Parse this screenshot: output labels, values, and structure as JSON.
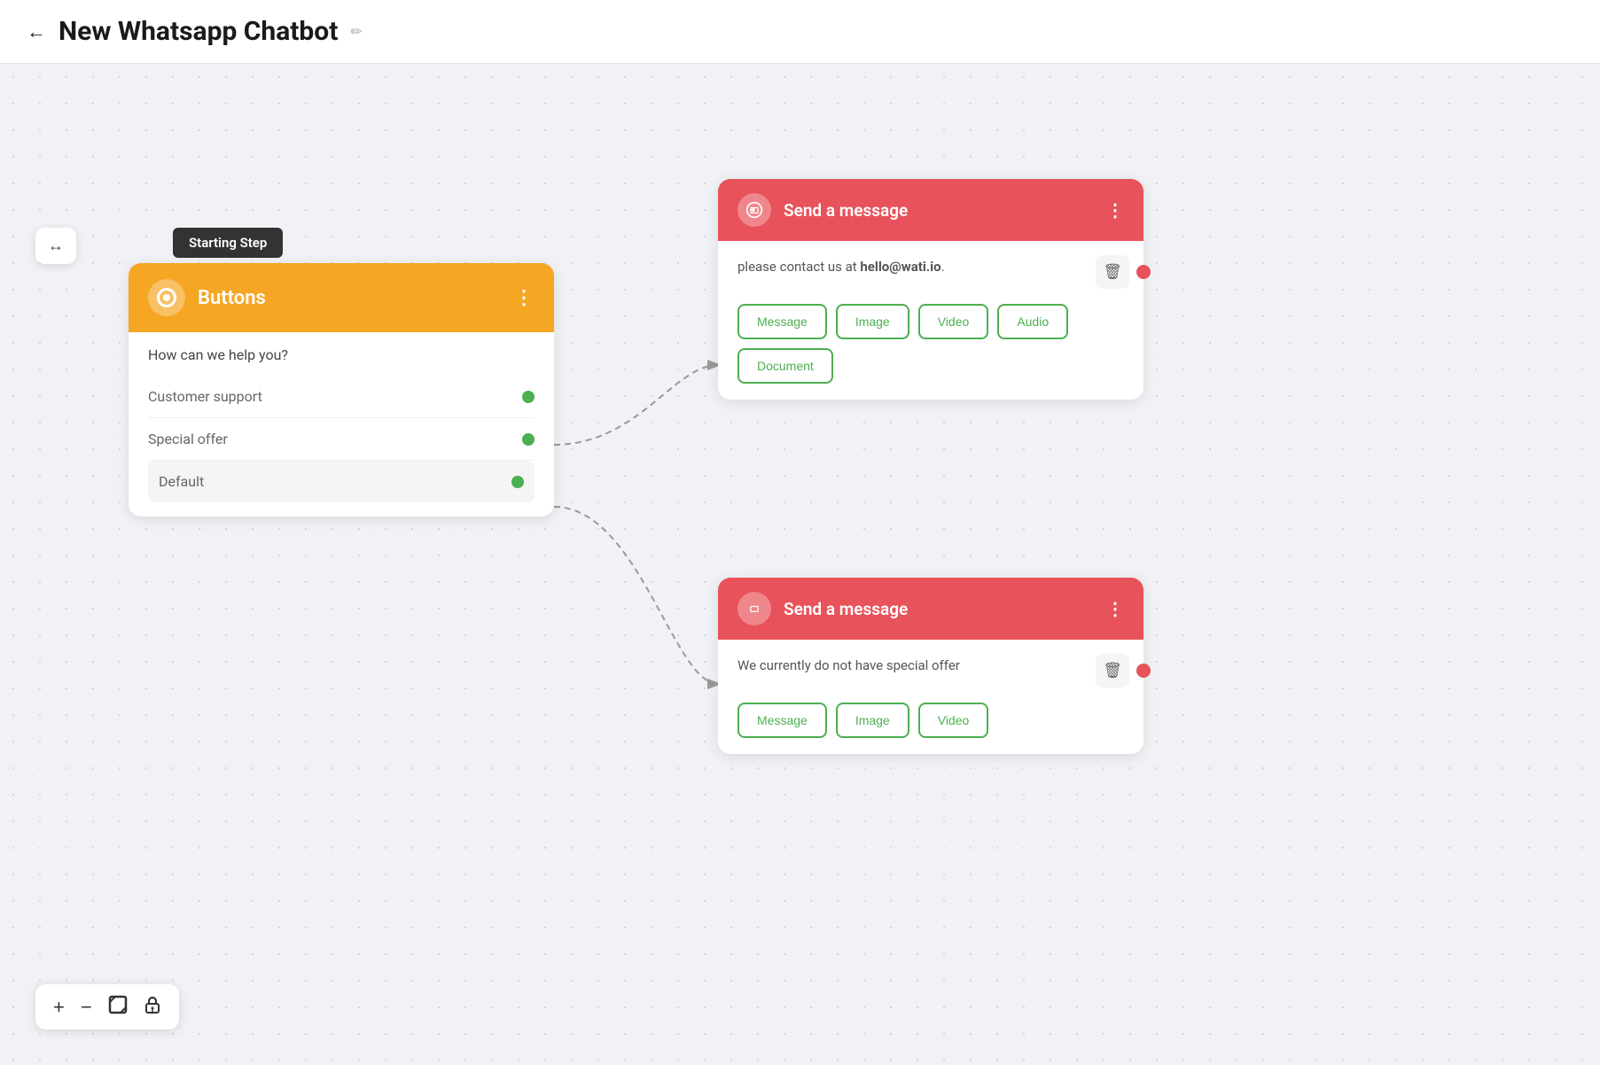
{
  "header": {
    "back_label": "←",
    "title": "New Whatsapp Chatbot",
    "edit_icon": "✏"
  },
  "canvas": {
    "starting_step_label": "Starting Step"
  },
  "buttons_node": {
    "title": "Buttons",
    "question": "How can we help you?",
    "menu_icon": "⋮",
    "buttons": [
      {
        "label": "Customer support"
      },
      {
        "label": "Special offer"
      },
      {
        "label": "Default"
      }
    ]
  },
  "zoom_controls": {
    "plus": "+",
    "minus": "−"
  },
  "send_card_1": {
    "title": "Send a message",
    "message": "please contact us at ",
    "message_bold": "hello@wati.io",
    "message_end": ".",
    "menu_icon": "⋮",
    "actions": [
      "Message",
      "Image",
      "Video",
      "Audio",
      "Document"
    ]
  },
  "send_card_2": {
    "title": "Send a message",
    "message": "We currently do not have special offer",
    "menu_icon": "⋮",
    "actions": [
      "Message",
      "Image",
      "Video"
    ]
  }
}
